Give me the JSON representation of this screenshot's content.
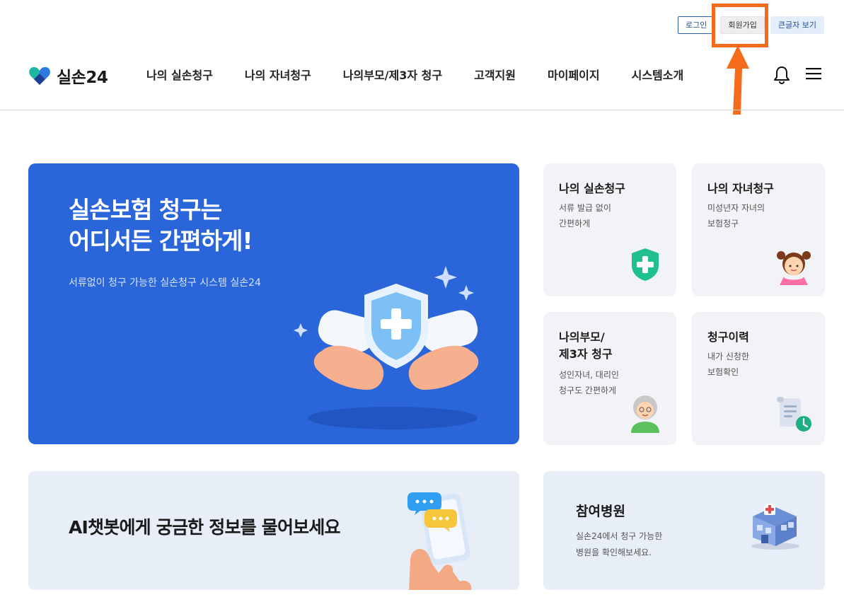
{
  "util": {
    "login": "로그인",
    "join": "회원가입",
    "big_text": "큰글자 보기"
  },
  "logo": {
    "text": "실손24"
  },
  "nav": [
    {
      "label": "나의 실손청구"
    },
    {
      "label": "나의 자녀청구"
    },
    {
      "label": "나의부모/제3자 청구"
    },
    {
      "label": "고객지원"
    },
    {
      "label": "마이페이지"
    },
    {
      "label": "시스템소개"
    }
  ],
  "hero": {
    "title_line1": "실손보험 청구는",
    "title_line2": "어디서든 간편하게!",
    "subtitle": "서류없이 청구 가능한 실손청구 시스템 실손24"
  },
  "cards": [
    {
      "title": "나의 실손청구",
      "desc_line1": "서류 발급 없이",
      "desc_line2": "간편하게",
      "icon": "shield-plus-icon"
    },
    {
      "title": "나의 자녀청구",
      "desc_line1": "미성년자 자녀의",
      "desc_line2": "보험청구",
      "icon": "child-icon"
    },
    {
      "title_line1": "나의부모/",
      "title_line2": "제3자 청구",
      "desc_line1": "성인자녀, 대리인",
      "desc_line2": "청구도 간편하게",
      "icon": "grandparent-icon"
    },
    {
      "title": "청구이력",
      "desc_line1": "내가 신청한",
      "desc_line2": "보험확인",
      "icon": "document-clock-icon"
    }
  ],
  "ai_banner": {
    "text": "AI챗봇에게 궁금한 정보를 물어보세요"
  },
  "hospital": {
    "title": "참여병원",
    "desc_line1": "실손24에서 청구 가능한",
    "desc_line2": "병원을 확인해보세요."
  },
  "colors": {
    "brand_blue": "#2a66d9",
    "card_bg": "#f2f3f6",
    "banner_bg": "#e8eef8",
    "highlight_orange": "#f46b1c"
  }
}
